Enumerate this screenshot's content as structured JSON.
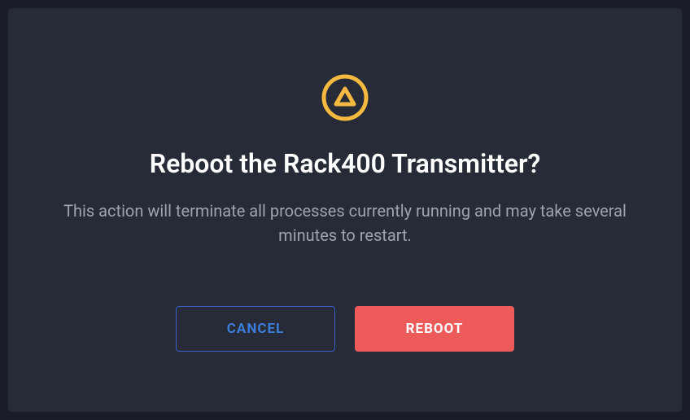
{
  "dialog": {
    "title": "Reboot the Rack400 Transmitter?",
    "body": "This action will terminate all processes currently running and may take several minutes to restart.",
    "cancel_label": "CANCEL",
    "confirm_label": "REBOOT"
  },
  "colors": {
    "warning": "#f5b942",
    "danger": "#ed5a5a",
    "link": "#3b7dd8"
  }
}
